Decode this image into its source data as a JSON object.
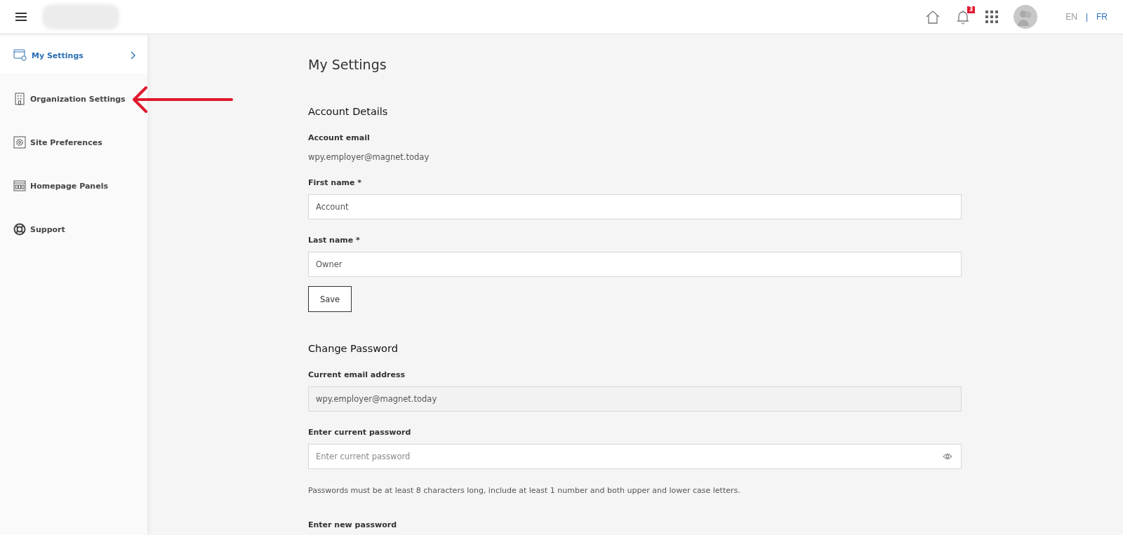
{
  "header": {
    "notification_count": "3",
    "languages": [
      {
        "label": "EN",
        "selected": false
      },
      {
        "label": "FR",
        "selected": true
      }
    ],
    "language_separator": "|"
  },
  "sidebar": {
    "items": [
      {
        "label": "My Settings",
        "selected": true
      },
      {
        "label": "Organization Settings",
        "selected": false
      },
      {
        "label": "Site Preferences",
        "selected": false
      },
      {
        "label": "Homepage Panels",
        "selected": false
      },
      {
        "label": "Support",
        "selected": false
      }
    ]
  },
  "page_title": "My Settings",
  "account_details": {
    "heading": "Account Details",
    "email_label": "Account email",
    "email": "wpy.employer@magnet.today",
    "fields": [
      {
        "label": "First name *",
        "value": "Account"
      },
      {
        "label": "Last name *",
        "value": "Owner"
      }
    ],
    "save_button": "Save"
  },
  "change_password": {
    "heading": "Change Password",
    "current_email": {
      "label": "Current email address",
      "value": "wpy.employer@magnet.today",
      "disabled": true
    },
    "current_password": {
      "label": "Enter current password",
      "placeholder": "Enter current password"
    },
    "hint": "Passwords must be at least 8 characters long, include at least 1 number and both upper and lower case letters.",
    "new_password_label": "Enter new password"
  }
}
